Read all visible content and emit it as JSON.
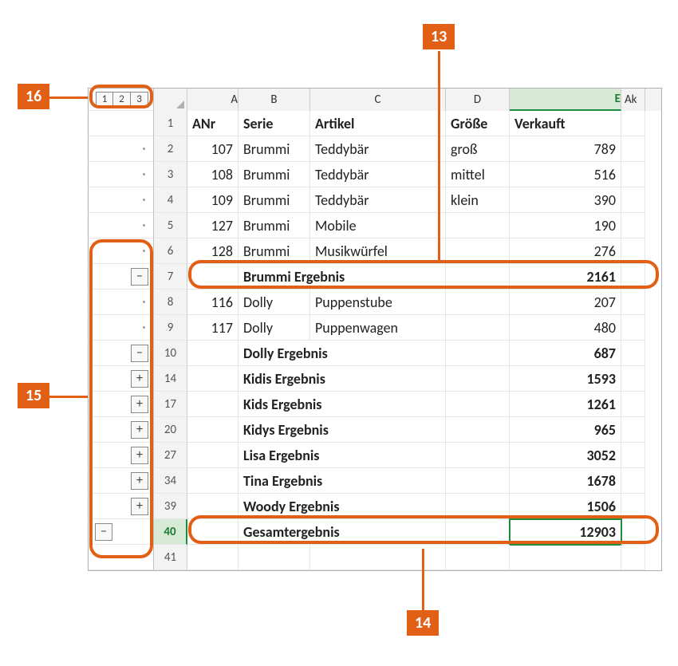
{
  "outline_levels": [
    "1",
    "2",
    "3"
  ],
  "col_headers": [
    "A",
    "B",
    "C",
    "D",
    "E"
  ],
  "col_f_hint": "Ak",
  "header_row": {
    "num": "1",
    "a": "ANr",
    "b": "Serie",
    "c": "Artikel",
    "d": "Größe",
    "e": "Verkauft"
  },
  "rows": [
    {
      "num": "2",
      "a": "107",
      "b": "Brummi",
      "c": "Teddybär",
      "d": "groß",
      "e": "789",
      "outline": "dot"
    },
    {
      "num": "3",
      "a": "108",
      "b": "Brummi",
      "c": "Teddybär",
      "d": "mittel",
      "e": "516",
      "outline": "dot"
    },
    {
      "num": "4",
      "a": "109",
      "b": "Brummi",
      "c": "Teddybär",
      "d": "klein",
      "e": "390",
      "outline": "dot"
    },
    {
      "num": "5",
      "a": "127",
      "b": "Brummi",
      "c": "Mobile",
      "d": "",
      "e": "190",
      "outline": "dot"
    },
    {
      "num": "6",
      "a": "128",
      "b": "Brummi",
      "c": "Musikwürfel",
      "d": "",
      "e": "276",
      "outline": "dot"
    },
    {
      "num": "7",
      "a": "",
      "b": "Brummi Ergebnis",
      "c": "",
      "d": "",
      "e": "2161",
      "outline": "minus",
      "bold": true,
      "span_bc": true
    },
    {
      "num": "8",
      "a": "116",
      "b": "Dolly",
      "c": "Puppenstube",
      "d": "",
      "e": "207",
      "outline": "dot"
    },
    {
      "num": "9",
      "a": "117",
      "b": "Dolly",
      "c": "Puppenwagen",
      "d": "",
      "e": "480",
      "outline": "dot"
    },
    {
      "num": "10",
      "a": "",
      "b": "Dolly Ergebnis",
      "c": "",
      "d": "",
      "e": "687",
      "outline": "minus",
      "bold": true,
      "span_bc": true
    },
    {
      "num": "14",
      "a": "",
      "b": "Kidis Ergebnis",
      "c": "",
      "d": "",
      "e": "1593",
      "outline": "plus",
      "bold": true,
      "span_bc": true
    },
    {
      "num": "17",
      "a": "",
      "b": "Kids Ergebnis",
      "c": "",
      "d": "",
      "e": "1261",
      "outline": "plus",
      "bold": true,
      "span_bc": true
    },
    {
      "num": "20",
      "a": "",
      "b": "Kidys Ergebnis",
      "c": "",
      "d": "",
      "e": "965",
      "outline": "plus",
      "bold": true,
      "span_bc": true
    },
    {
      "num": "27",
      "a": "",
      "b": "Lisa Ergebnis",
      "c": "",
      "d": "",
      "e": "3052",
      "outline": "plus",
      "bold": true,
      "span_bc": true
    },
    {
      "num": "34",
      "a": "",
      "b": "Tina Ergebnis",
      "c": "",
      "d": "",
      "e": "1678",
      "outline": "plus",
      "bold": true,
      "span_bc": true
    },
    {
      "num": "39",
      "a": "",
      "b": "Woody Ergebnis",
      "c": "",
      "d": "",
      "e": "1506",
      "outline": "plus",
      "bold": true,
      "span_bc": true
    },
    {
      "num": "40",
      "a": "",
      "b": "Gesamtergebnis",
      "c": "",
      "d": "",
      "e": "12903",
      "outline": "minus1",
      "bold": true,
      "span_bc": true,
      "selected": true
    },
    {
      "num": "41",
      "a": "",
      "b": "",
      "c": "",
      "d": "",
      "e": "",
      "outline": "none"
    }
  ],
  "callouts": {
    "c13": "13",
    "c14": "14",
    "c15": "15",
    "c16": "16"
  },
  "toggle_minus": "−",
  "toggle_plus": "+"
}
